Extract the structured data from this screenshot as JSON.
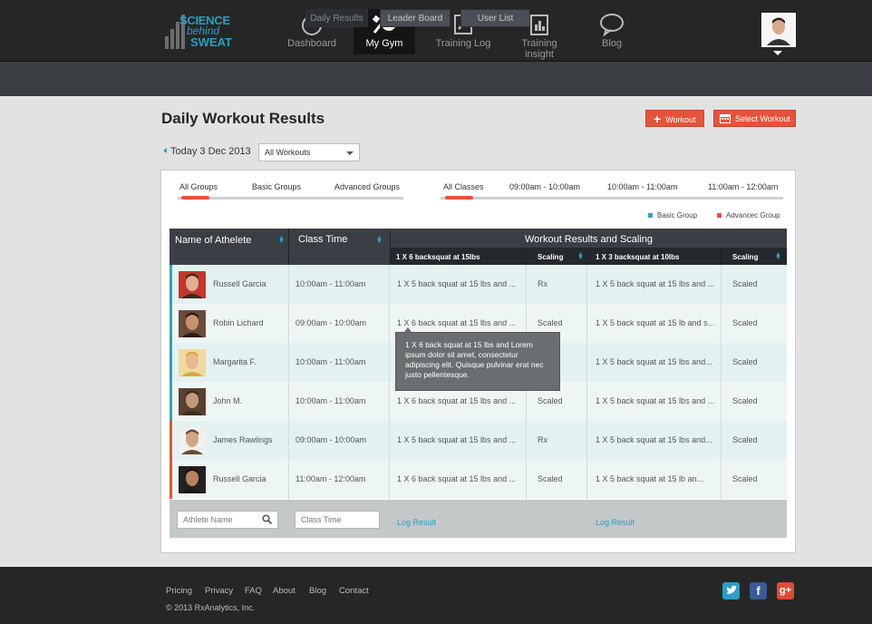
{
  "brand": {
    "line1": "SCIENCE",
    "line2": "behind",
    "line3": "SWEAT"
  },
  "nav": [
    {
      "label": "Dashboard",
      "icon": "dashboard-gauge-icon"
    },
    {
      "label": "My Gym",
      "icon": "dumbbell-icon",
      "active": true
    },
    {
      "label": "Training Log",
      "icon": "pencil-log-icon"
    },
    {
      "label": "Training insight",
      "icon": "chart-clipboard-icon"
    },
    {
      "label": "Blog",
      "icon": "speech-bubble-icon"
    }
  ],
  "subnav": [
    "Daily Results",
    "Leader Board",
    "User List"
  ],
  "page": {
    "title": "Daily Workout Results",
    "workout_button": "Workout",
    "select_workout_button": "Select Workout",
    "date": "Today 3 Dec 2013",
    "select_value": "All Workouts"
  },
  "groups": [
    "All Groups",
    "Basic Groups",
    "Advanced Groups"
  ],
  "classes": [
    "All Classes",
    "09:00am - 10:00am",
    "10:00am - 11:00am",
    "11:00am - 12:00am"
  ],
  "legend": {
    "basic": "Basic Group",
    "advanced": "Advancec Group",
    "basic_color": "#3aa0b5",
    "advanced_color": "#e6533c"
  },
  "table": {
    "col_name": "Name of Athelete",
    "col_time": "Class Time",
    "col_results": "Workout Results and Scaling",
    "sub1": "1 X 6 backsquat at 15lbs",
    "sub2": "Scaling",
    "sub3": "1 X 3 backsquat at 10lbs",
    "sub4": "Scaling",
    "rows": [
      {
        "name": "Russell Garcia",
        "time": "10:00am - 11:00am",
        "r1": "1 X 5 back squat at 15 lbs and ...",
        "s1": "Rx",
        "r2": "1 X 5 back squat at 15 lbs and ...",
        "s2": "Scaled",
        "group": "basic"
      },
      {
        "name": "Robin Lichard",
        "time": "09:00am - 10:00am",
        "r1": "1 X 6 back squat at 15 lbs and ...",
        "s1": "Scaled",
        "r2": "1 X 5 back squat at 15 lb and s...",
        "s2": "Scaled",
        "group": "basic"
      },
      {
        "name": "Margarita F.",
        "time": "10:00am - 11:00am",
        "r1": "",
        "s1": "",
        "r2": "1 X 5 back squat at 15 lbs and...",
        "s2": "Scaled",
        "group": "basic"
      },
      {
        "name": "John M.",
        "time": "10:00am - 11:00am",
        "r1": "1 X 6 back squat at 15 lbs and ...",
        "s1": "Scaled",
        "r2": "1 X 5 back squat at 15 lbs and ...",
        "s2": "Scaled",
        "group": "basic"
      },
      {
        "name": "James Rawlings",
        "time": "09:00am - 10:00am",
        "r1": "1 X 5 back squat at 15 lbs and ...",
        "s1": "Rx",
        "r2": "1 X 5 back squat at 15 lbs and...",
        "s2": "Scaled",
        "group": "advanced"
      },
      {
        "name": "Russell Garcia",
        "time": "11:00am - 12:00am",
        "r1": "1 X 6 back squat at 15 lbs and ...",
        "s1": "Scaled",
        "r2": "1 X 5 back squat at 15 lb an...",
        "s2": "Scaled",
        "group": "advanced"
      }
    ],
    "athlete_placeholder": "Athlete Name",
    "class_placeholder": "Class Time",
    "log_result": "Log Result"
  },
  "tooltip": "1 X 6 back squat at 15 lbs and Lorem ipsum dolor sit amet, consectetur adipiscing elit. Quisque pulvinar erat nec justo pellentesque.",
  "footer": {
    "links": [
      "Pricing",
      "Privacy",
      "FAQ",
      "About",
      "Blog",
      "Contact"
    ],
    "copyright": "© 2013 RxAnalytics, Inc."
  }
}
